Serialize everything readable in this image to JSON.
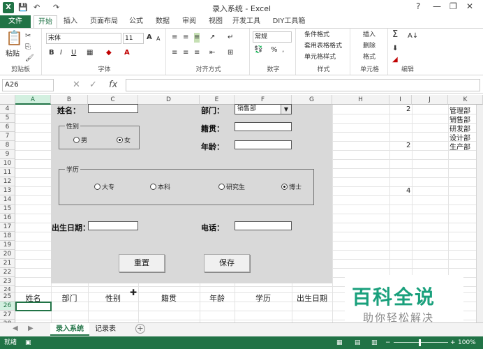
{
  "window": {
    "title": "录入系统 - Excel",
    "help": "?",
    "minimize": "—",
    "restore": "❐",
    "close": "✕"
  },
  "quick_access": {
    "save": "💾",
    "undo": "↶",
    "redo": "↷"
  },
  "ribbon_tabs": [
    "文件",
    "开始",
    "插入",
    "页面布局",
    "公式",
    "数据",
    "审阅",
    "视图",
    "开发工具",
    "DIY工具箱"
  ],
  "ribbon": {
    "clipboard": {
      "label": "剪贴板",
      "paste": "粘贴"
    },
    "font": {
      "label": "字体",
      "name": "宋体",
      "size": "11",
      "bold": "B",
      "italic": "I",
      "underline": "U",
      "grow": "A",
      "shrink": "A"
    },
    "alignment": {
      "label": "对齐方式"
    },
    "number": {
      "label": "数字",
      "format": "常规",
      "percent": "%"
    },
    "styles": {
      "label": "样式",
      "conditional": "条件格式",
      "table": "套用表格格式",
      "cell": "单元格样式"
    },
    "cells": {
      "label": "单元格",
      "insert": "插入",
      "delete": "删除",
      "format": "格式"
    },
    "editing": {
      "label": "编辑",
      "sum": "Σ",
      "sort": "A↓"
    }
  },
  "formula_bar": {
    "name_box": "A26",
    "fx": "fx",
    "value": ""
  },
  "columns": [
    "A",
    "B",
    "C",
    "D",
    "E",
    "F",
    "G",
    "H",
    "I",
    "J",
    "K"
  ],
  "rows": [
    "4",
    "5",
    "6",
    "7",
    "8",
    "9",
    "10",
    "11",
    "12",
    "13",
    "14",
    "15",
    "16",
    "17",
    "18",
    "19",
    "20",
    "21",
    "22",
    "23",
    "24",
    "25",
    "26",
    "27",
    "28"
  ],
  "cells": {
    "I4": "2",
    "I8": "2",
    "I13": "4",
    "K4": "管理部",
    "K5": "销售部",
    "K6": "研发部",
    "K7": "设计部",
    "K8": "生产部"
  },
  "form": {
    "name_label": "姓名：",
    "dept_label": "部门：",
    "dept_value": "销售部",
    "native_label": "籍贯：",
    "age_label": "年龄：",
    "gender": {
      "title": "性别",
      "options": [
        "男",
        "女"
      ],
      "selected": "女"
    },
    "education": {
      "title": "学历",
      "options": [
        "大专",
        "本科",
        "研究生",
        "博士"
      ],
      "selected": "博士"
    },
    "birthdate_label": "出生日期：",
    "phone_label": "电话：",
    "reset_button": "重置",
    "save_button": "保存"
  },
  "table_headers": [
    "姓名",
    "部门",
    "性别",
    "籍贯",
    "年龄",
    "学历",
    "出生日期"
  ],
  "sheet_tabs": [
    "录入系统",
    "记录表"
  ],
  "status": {
    "ready": "就绪",
    "zoom": "100%"
  },
  "watermark": {
    "main": "百科全说",
    "sub": "助你轻松解决"
  },
  "colors": {
    "excel_green": "#217346",
    "form_bg": "#d9d9d9",
    "watermark": "#1aa07c"
  }
}
